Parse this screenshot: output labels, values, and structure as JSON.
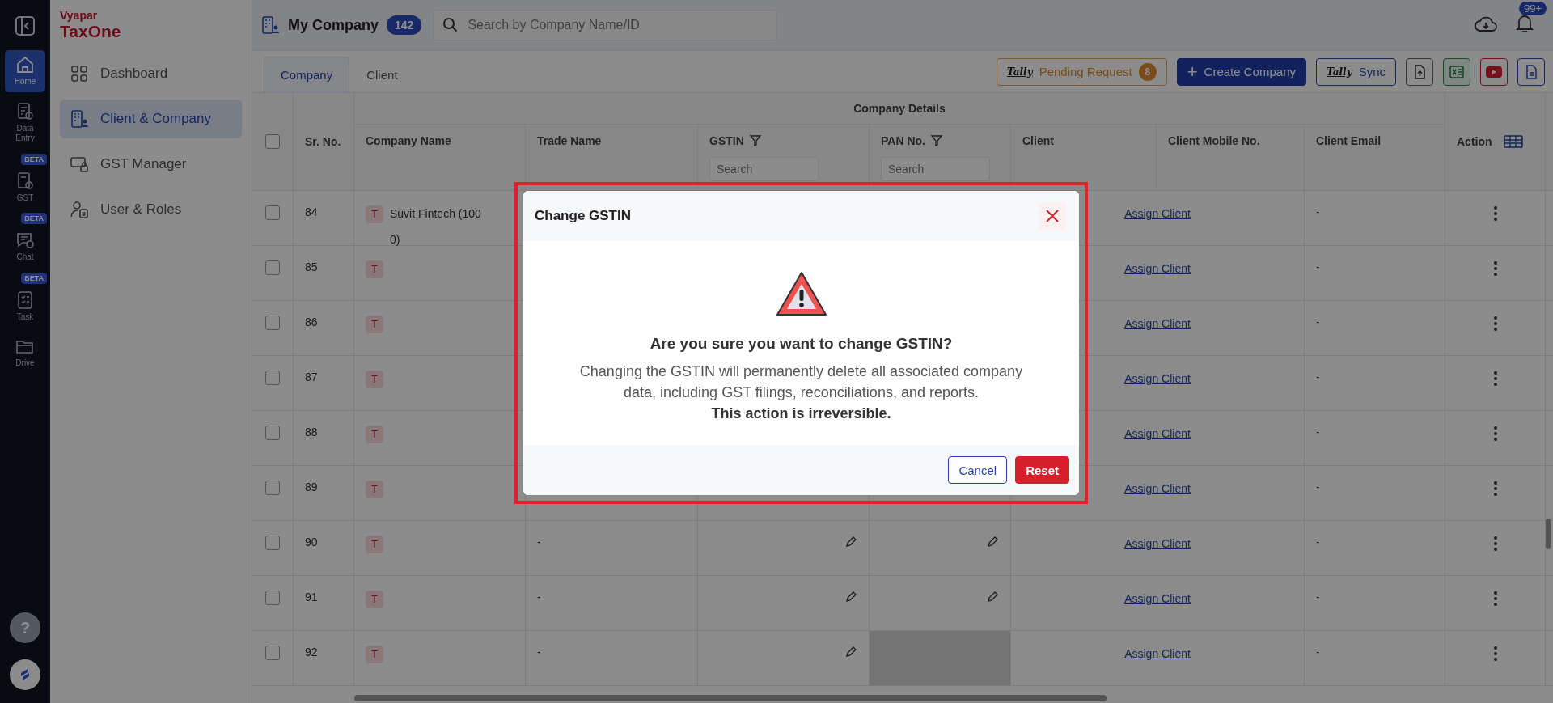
{
  "brand": {
    "line_1": "Vyapar",
    "line_2": "TaxOne"
  },
  "rail": {
    "items": [
      {
        "label": "Home",
        "selected": true
      },
      {
        "label": "Data Entry",
        "selected": false
      },
      {
        "label": "GST",
        "badge": "BETA",
        "selected": false
      },
      {
        "label": "Chat",
        "badge": "BETA",
        "selected": false
      },
      {
        "label": "Task",
        "badge": "BETA",
        "selected": false
      },
      {
        "label": "Drive",
        "selected": false
      }
    ],
    "help": "?"
  },
  "sidebar": {
    "items": [
      {
        "label": "Dashboard",
        "selected": false
      },
      {
        "label": "Client & Company",
        "selected": true
      },
      {
        "label": "GST Manager",
        "selected": false
      },
      {
        "label": "User & Roles",
        "selected": false
      }
    ]
  },
  "header": {
    "title": "My Company",
    "count": "142",
    "search_placeholder": "Search by Company Name/ID",
    "notifications": "99+"
  },
  "tabs": [
    {
      "label": "Company",
      "selected": true
    },
    {
      "label": "Client",
      "selected": false
    }
  ],
  "actions": {
    "pending": {
      "logo": "Tally",
      "label": "Pending Request",
      "count": "8"
    },
    "create": {
      "icon": "+",
      "label": "Create Company"
    },
    "sync": {
      "logo": "Tally",
      "label": "Sync"
    }
  },
  "table": {
    "select_all": {
      "checked": false
    },
    "sr_header": "Sr. No.",
    "group_header": "Company Details",
    "action_header": "Action",
    "columns": [
      {
        "label": "Company Name"
      },
      {
        "label": "Trade Name"
      },
      {
        "label": "GSTIN",
        "search_placeholder": "Search"
      },
      {
        "label": "PAN No.",
        "search_placeholder": "Search"
      },
      {
        "label": "Client"
      },
      {
        "label": "Client Mobile No."
      },
      {
        "label": "Client Email"
      }
    ],
    "rows": [
      {
        "checked": false,
        "sr": "84",
        "avatar": "T",
        "name_lines": [
          "Suvit Fintech (100",
          "0)"
        ],
        "client": "Assign Client",
        "email": "-"
      },
      {
        "checked": false,
        "sr": "85",
        "avatar": "T",
        "client": "Assign Client",
        "email": "-"
      },
      {
        "checked": false,
        "sr": "86",
        "avatar": "T",
        "client": "Assign Client",
        "email": "-"
      },
      {
        "checked": false,
        "sr": "87",
        "avatar": "T",
        "client": "Assign Client",
        "email": "-"
      },
      {
        "checked": false,
        "sr": "88",
        "avatar": "T",
        "client": "Assign Client",
        "email": "-"
      },
      {
        "checked": false,
        "sr": "89",
        "avatar": "T",
        "client": "Assign Client",
        "email": "-"
      },
      {
        "checked": false,
        "sr": "90",
        "avatar": "T",
        "trade_name": "-",
        "gstin_edit": true,
        "pan_edit": true,
        "client": "Assign Client",
        "email": "-"
      },
      {
        "checked": false,
        "sr": "91",
        "avatar": "T",
        "trade_name": "-",
        "gstin_edit": true,
        "pan_edit": true,
        "client": "Assign Client",
        "email": "-"
      },
      {
        "checked": false,
        "sr": "92",
        "avatar": "T",
        "trade_name": "-",
        "gstin_edit": true,
        "pan_edit": false,
        "client": "Assign Client",
        "email": "-"
      }
    ]
  },
  "modal": {
    "title": "Change GSTIN",
    "heading": "Are you sure you want to change GSTIN?",
    "message": "Changing the GSTIN will permanently delete all associated company data, including GST filings, reconciliations, and reports. **This action is irreversible.**",
    "buttons": [
      {
        "label": "Cancel",
        "kind": "secondary"
      },
      {
        "label": "Reset",
        "kind": "danger"
      }
    ]
  }
}
